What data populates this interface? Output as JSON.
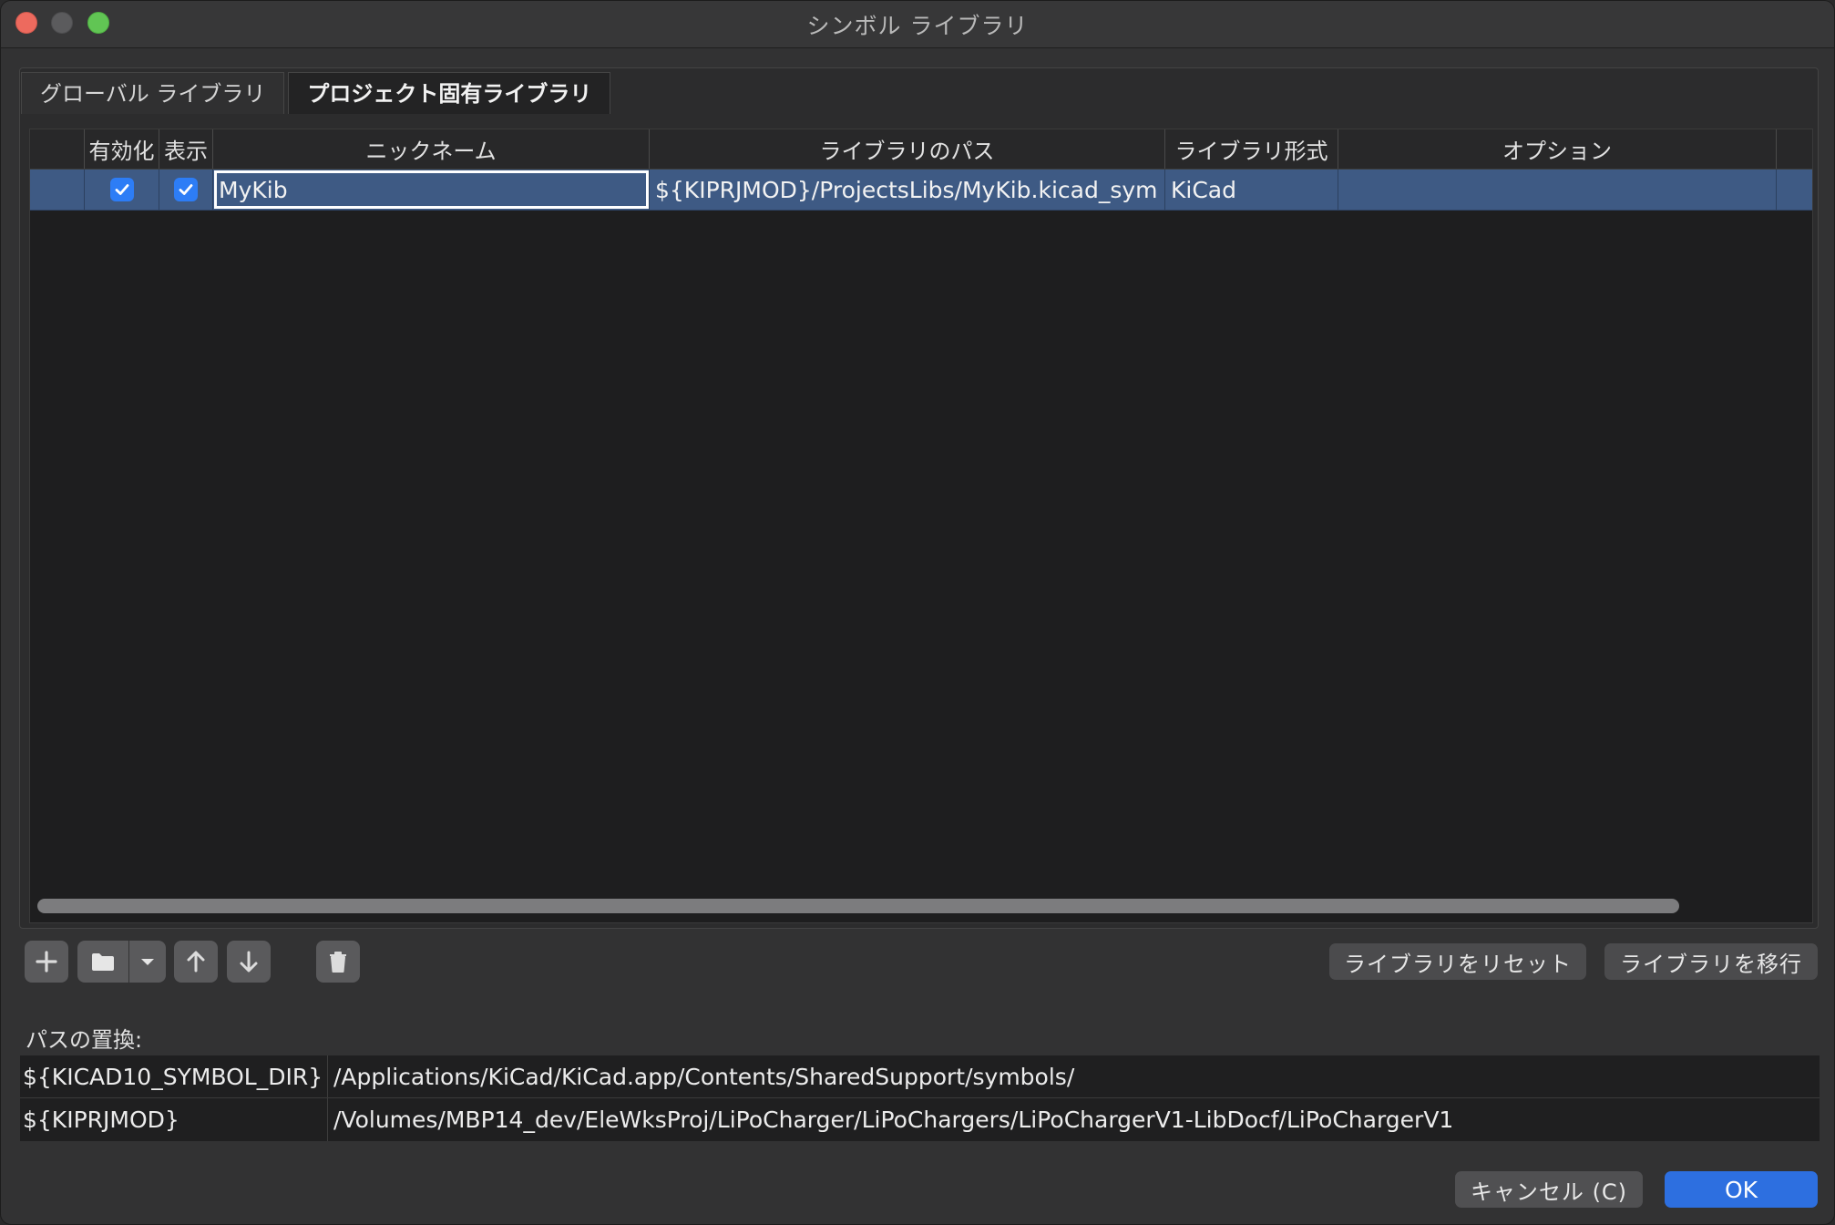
{
  "window": {
    "title": "シンボル ライブラリ"
  },
  "tabs": [
    {
      "label": "グローバル ライブラリ",
      "active": false
    },
    {
      "label": "プロジェクト固有ライブラリ",
      "active": true
    }
  ],
  "grid": {
    "columns": {
      "enabled": "有効化",
      "visible": "表示",
      "nickname": "ニックネーム",
      "path": "ライブラリのパス",
      "format": "ライブラリ形式",
      "options": "オプション"
    },
    "rows": [
      {
        "enabled": true,
        "visible": true,
        "nickname": "MyKib",
        "path": "${KIPRJMOD}/ProjectsLibs/MyKib.kicad_sym",
        "format": "KiCad",
        "options": ""
      }
    ]
  },
  "toolbar": {
    "reset_label": "ライブラリをリセット",
    "migrate_label": "ライブラリを移行"
  },
  "path_substitution": {
    "label": "パスの置換:",
    "rows": [
      {
        "key": "${KICAD10_SYMBOL_DIR}",
        "value": "/Applications/KiCad/KiCad.app/Contents/SharedSupport/symbols/"
      },
      {
        "key": "${KIPRJMOD}",
        "value": "/Volumes/MBP14_dev/EleWksProj/LiPoCharger/LiPoChargers/LiPoChargerV1-LibDocf/LiPoChargerV1"
      }
    ]
  },
  "dialog": {
    "cancel_label": "キャンセル (C)",
    "ok_label": "OK"
  },
  "colors": {
    "selected_row": "#3e5a84",
    "ok_button": "#2d6fe0",
    "checkbox": "#2d7df6"
  }
}
